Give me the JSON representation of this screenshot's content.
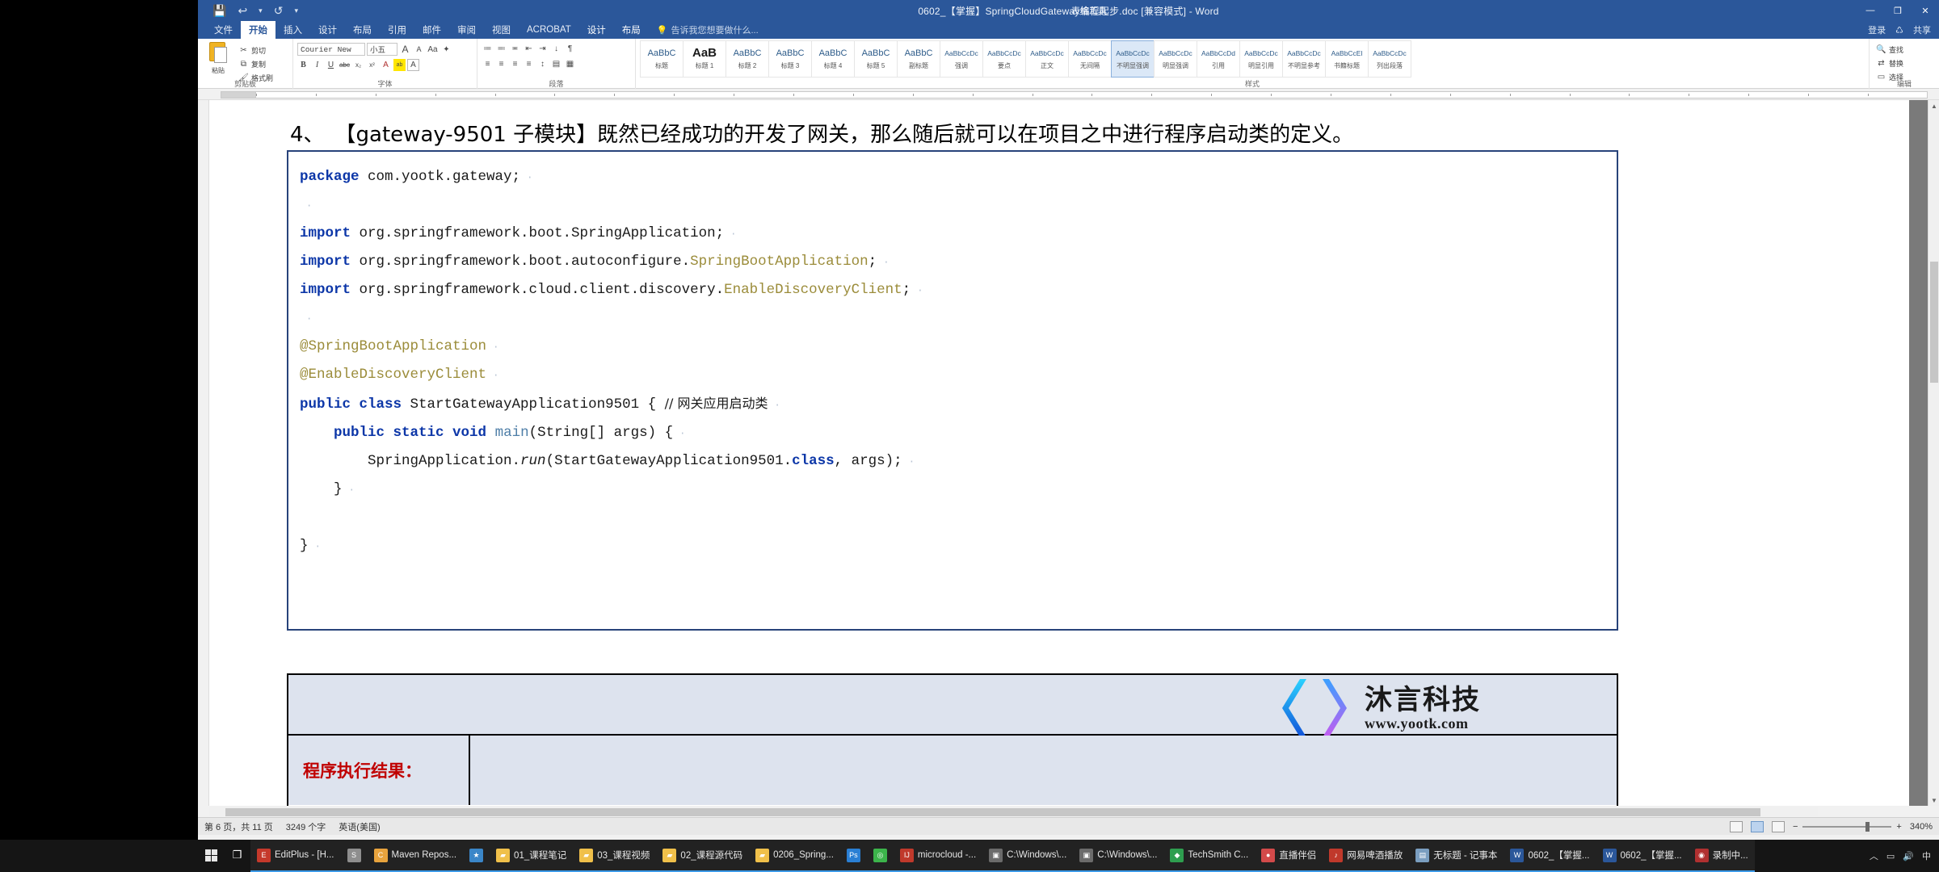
{
  "window": {
    "title": "0602_【掌握】SpringCloudGateway编程起步.doc [兼容模式] - Word",
    "contextual_tab_label": "表格工具",
    "minimize": "—",
    "maximize": "❐",
    "close": "✕"
  },
  "quick_access": {
    "save": "💾",
    "undo": "↩",
    "undo_arrow": "▾",
    "redo": "↺",
    "customize": "▾"
  },
  "account": {
    "signin": "登录",
    "share": "共享",
    "share_icon": "♺"
  },
  "tabs": [
    {
      "label": "文件",
      "active": false
    },
    {
      "label": "开始",
      "active": true
    },
    {
      "label": "插入",
      "active": false
    },
    {
      "label": "设计",
      "active": false
    },
    {
      "label": "布局",
      "active": false
    },
    {
      "label": "引用",
      "active": false
    },
    {
      "label": "邮件",
      "active": false
    },
    {
      "label": "审阅",
      "active": false
    },
    {
      "label": "视图",
      "active": false
    },
    {
      "label": "ACROBAT",
      "active": false
    }
  ],
  "contextual_tabs": [
    {
      "label": "设计"
    },
    {
      "label": "布局"
    }
  ],
  "tell_me": "告诉我您想要做什么...",
  "ribbon": {
    "groups": [
      {
        "name": "剪贴板",
        "label": "剪贴板"
      },
      {
        "name": "字体",
        "label": "字体"
      },
      {
        "name": "段落",
        "label": "段落"
      },
      {
        "name": "样式",
        "label": "样式"
      },
      {
        "name": "编辑",
        "label": "编辑"
      }
    ],
    "clipboard": {
      "paste_label": "粘贴",
      "cut_label": "剪切",
      "copy_label": "复制",
      "format_painter_label": "格式刷"
    },
    "font": {
      "font_name": "Courier New",
      "font_size": "小五",
      "grow_font": "A",
      "shrink_font": "A",
      "change_case": "Aa",
      "clear_format": "✦",
      "bold": "B",
      "italic": "I",
      "underline": "U",
      "strikethrough": "abc",
      "subscript": "x₂",
      "superscript": "x²",
      "text_effects": "A",
      "highlight": "ab",
      "font_color": "A"
    },
    "paragraph": {
      "bullets": "≔",
      "numbering": "≕",
      "multilevel": "≖",
      "decrease_indent": "⇤",
      "increase_indent": "⇥",
      "sort": "↓",
      "show_marks": "¶",
      "align_left": "≡",
      "align_center": "≡",
      "align_right": "≡",
      "justify": "≡",
      "line_spacing": "↕",
      "shading": "▤",
      "borders": "▦"
    },
    "styles": [
      {
        "preview": "AaBbC",
        "name": "标题",
        "selected": false
      },
      {
        "preview": "AaB",
        "name": "标题 1",
        "selected": false
      },
      {
        "preview": "AaBbC",
        "name": "标题 2",
        "selected": false
      },
      {
        "preview": "AaBbC",
        "name": "标题 3",
        "selected": false
      },
      {
        "preview": "AaBbC",
        "name": "标题 4",
        "selected": false
      },
      {
        "preview": "AaBbC",
        "name": "标题 5",
        "selected": false
      },
      {
        "preview": "AaBbC",
        "name": "副标题",
        "selected": false
      },
      {
        "preview": "AaBbCcDc",
        "name": "强调",
        "selected": false
      },
      {
        "preview": "AaBbCcDc",
        "name": "要点",
        "selected": false
      },
      {
        "preview": "AaBbCcDc",
        "name": "正文",
        "selected": false
      },
      {
        "preview": "AaBbCcDc",
        "name": "无间隔",
        "selected": false
      },
      {
        "preview": "AaBbCcDc",
        "name": "不明显强调",
        "selected": true
      },
      {
        "preview": "AaBbCcDc",
        "name": "明显强调",
        "selected": false
      },
      {
        "preview": "AaBbCcDd",
        "name": "引用",
        "selected": false
      },
      {
        "preview": "AaBbCcDc",
        "name": "明显引用",
        "selected": false
      },
      {
        "preview": "AaBbCcDc",
        "name": "不明显参考",
        "selected": false
      },
      {
        "preview": "AaBbCcEl",
        "name": "书籍标题",
        "selected": false
      },
      {
        "preview": "AaBbCcDc",
        "name": "列出段落",
        "selected": false
      }
    ],
    "editing": {
      "find": "查找",
      "replace": "替换",
      "select": "选择"
    }
  },
  "document": {
    "heading": {
      "number": "4、",
      "text": "【gateway-9501 子模块】既然已经成功的开发了网关，那么随后就可以在项目之中进行程序启动类的定义。"
    },
    "code_lines": [
      [
        {
          "t": "package",
          "c": "kw"
        },
        {
          "t": " com.yootk.gateway;",
          "c": ""
        },
        {
          "t": " ·",
          "c": "pmark"
        }
      ],
      [
        {
          "t": " ·",
          "c": "pmark"
        }
      ],
      [
        {
          "t": "import",
          "c": "kw"
        },
        {
          "t": " org.springframework.boot.SpringApplication;",
          "c": ""
        },
        {
          "t": " ·",
          "c": "pmark"
        }
      ],
      [
        {
          "t": "import",
          "c": "kw"
        },
        {
          "t": " org.springframework.boot.autoconfigure.",
          "c": ""
        },
        {
          "t": "SpringBootApplication",
          "c": "cls"
        },
        {
          "t": ";",
          "c": ""
        },
        {
          "t": " ·",
          "c": "pmark"
        }
      ],
      [
        {
          "t": "import",
          "c": "kw"
        },
        {
          "t": " org.springframework.cloud.client.discovery.",
          "c": ""
        },
        {
          "t": "EnableDiscoveryClient",
          "c": "cls"
        },
        {
          "t": ";",
          "c": ""
        },
        {
          "t": " ·",
          "c": "pmark"
        }
      ],
      [
        {
          "t": " ·",
          "c": "pmark"
        }
      ],
      [
        {
          "t": "@SpringBootApplication",
          "c": "cls"
        },
        {
          "t": " ·",
          "c": "pmark"
        }
      ],
      [
        {
          "t": "@EnableDiscoveryClient",
          "c": "cls"
        },
        {
          "t": " ·",
          "c": "pmark"
        }
      ],
      [
        {
          "t": "public class",
          "c": "kw"
        },
        {
          "t": " StartGatewayApplication9501 { ",
          "c": ""
        },
        {
          "t": "// 网关应用启动类",
          "c": "cmt"
        },
        {
          "t": " ·",
          "c": "pmark"
        }
      ],
      [
        {
          "t": "    ",
          "c": ""
        },
        {
          "t": "public static void",
          "c": "kw"
        },
        {
          "t": " ",
          "c": ""
        },
        {
          "t": "main",
          "c": "meth"
        },
        {
          "t": "(String[] args) {",
          "c": ""
        },
        {
          "t": " ·",
          "c": "pmark"
        }
      ],
      [
        {
          "t": "        SpringApplication.",
          "c": ""
        },
        {
          "t": "run",
          "c": "ital"
        },
        {
          "t": "(StartGatewayApplication9501.",
          "c": ""
        },
        {
          "t": "class",
          "c": "kw"
        },
        {
          "t": ", args);",
          "c": ""
        },
        {
          "t": " ·",
          "c": "pmark"
        }
      ],
      [
        {
          "t": "    }",
          "c": ""
        },
        {
          "t": " ·",
          "c": "pmark"
        }
      ],
      [
        {
          "t": "",
          "c": ""
        }
      ],
      [
        {
          "t": "}",
          "c": ""
        },
        {
          "t": " ·",
          "c": "pmark"
        }
      ]
    ],
    "result_table": {
      "label": "程序执行结果："
    },
    "logo": {
      "company": "沐言科技",
      "url": "www.yootk.com"
    }
  },
  "status_bar": {
    "page_info": "第 6 页，共 11 页",
    "word_count": "3249 个字",
    "language": "英语(美国)",
    "zoom_out": "−",
    "zoom_in": "+",
    "zoom_level": "340%"
  },
  "taskbar": {
    "start": "⊞",
    "task_view": "❒",
    "items": [
      {
        "label": "EditPlus - [H...",
        "icon": "E",
        "color": "#c5392b",
        "running": true
      },
      {
        "label": "",
        "icon": "S",
        "color": "#8e8e8e",
        "running": true
      },
      {
        "label": "Maven Repos...",
        "icon": "C",
        "color": "#e8a33d",
        "running": true
      },
      {
        "label": "",
        "icon": "★",
        "color": "#3a86c8",
        "running": true
      },
      {
        "label": "01_课程笔记",
        "icon": "▰",
        "color": "#f0c04a",
        "running": true
      },
      {
        "label": "03_课程视频",
        "icon": "▰",
        "color": "#f0c04a",
        "running": true
      },
      {
        "label": "02_课程源代码",
        "icon": "▰",
        "color": "#f0c04a",
        "running": true
      },
      {
        "label": "0206_Spring...",
        "icon": "▰",
        "color": "#f0c04a",
        "running": true
      },
      {
        "label": "",
        "icon": "Ps",
        "color": "#2a7fd4",
        "running": true
      },
      {
        "label": "",
        "icon": "◎",
        "color": "#3cb44b",
        "running": true
      },
      {
        "label": "microcloud -...",
        "icon": "IJ",
        "color": "#c0392b",
        "running": true
      },
      {
        "label": "C:\\Windows\\...",
        "icon": "▣",
        "color": "#6b6b6b",
        "running": true
      },
      {
        "label": "C:\\Windows\\...",
        "icon": "▣",
        "color": "#6b6b6b",
        "running": true
      },
      {
        "label": "TechSmith C...",
        "icon": "◆",
        "color": "#2e9e4f",
        "running": true
      },
      {
        "label": "直播伴侣",
        "icon": "●",
        "color": "#d34a4a",
        "running": true
      },
      {
        "label": "网易啤酒播放",
        "icon": "♪",
        "color": "#c0392b",
        "running": true
      },
      {
        "label": "无标题 - 记事本",
        "icon": "▤",
        "color": "#7a9ec0",
        "running": true
      },
      {
        "label": "0602_【掌握...",
        "icon": "W",
        "color": "#2b579a",
        "running": true
      },
      {
        "label": "0602_【掌握...",
        "icon": "W",
        "color": "#2b579a",
        "running": true
      },
      {
        "label": "录制中...",
        "icon": "◉",
        "color": "#b03030",
        "running": true
      }
    ],
    "tray": {
      "up": "︿",
      "network": "▭",
      "volume": "🔊",
      "lang": "中"
    }
  }
}
